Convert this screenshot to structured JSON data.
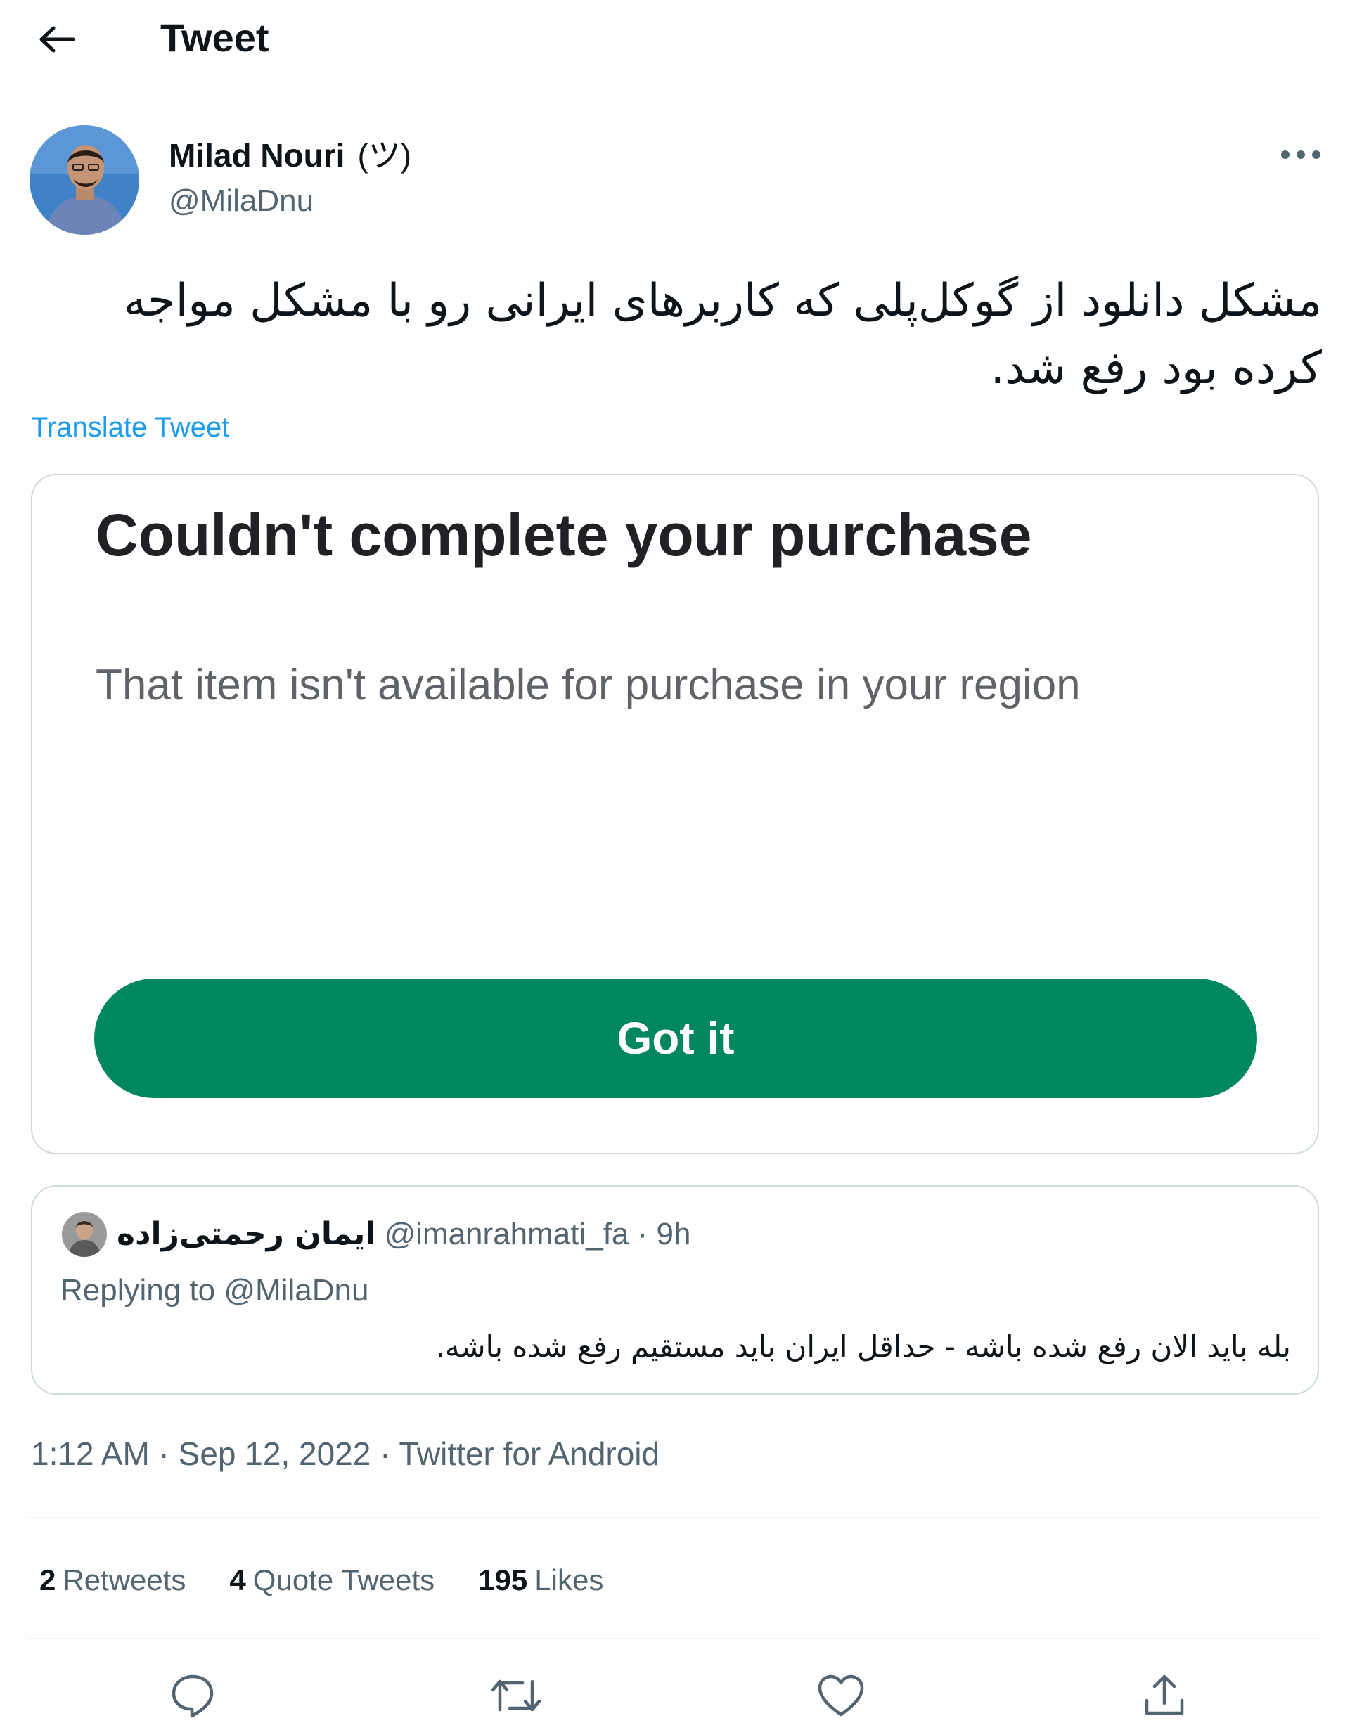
{
  "header": {
    "title": "Tweet",
    "back_icon": "arrow-left-icon"
  },
  "author": {
    "name": "Milad Nouri",
    "kaomoji": "(ツ)",
    "handle": "@MilaDnu"
  },
  "tweet": {
    "text": "مشکل دانلود از گوکل‌پلی که کاربرهای ایرانی رو با مشکل مواجه کرده بود رفع شد.",
    "translate_label": "Translate Tweet"
  },
  "media": {
    "dialog_title": "Couldn't complete your purchase",
    "dialog_body": "That item isn't available for purchase in your region",
    "button_label": "Got it",
    "button_color": "#01875f"
  },
  "quoted": {
    "name": "ایمان رحمتی‌زاده",
    "meta": "@imanrahmati_fa · 9h",
    "replying_prefix": "Replying to",
    "replying_handle": "@MilaDnu",
    "text": "بله باید الان رفع شده باشه - حداقل ایران باید مستقیم رفع شده باشه."
  },
  "timestamp": "1:12 AM · Sep 12, 2022 · Twitter for Android",
  "stats": {
    "retweets_count": "2",
    "retweets_label": "Retweets",
    "quotes_count": "4",
    "quotes_label": "Quote Tweets",
    "likes_count": "195",
    "likes_label": "Likes"
  },
  "actions": [
    "reply-icon",
    "retweet-icon",
    "like-icon",
    "share-icon"
  ],
  "colors": {
    "link": "#1d9bf0",
    "secondary_text": "#536471",
    "border": "#cfd9de"
  }
}
